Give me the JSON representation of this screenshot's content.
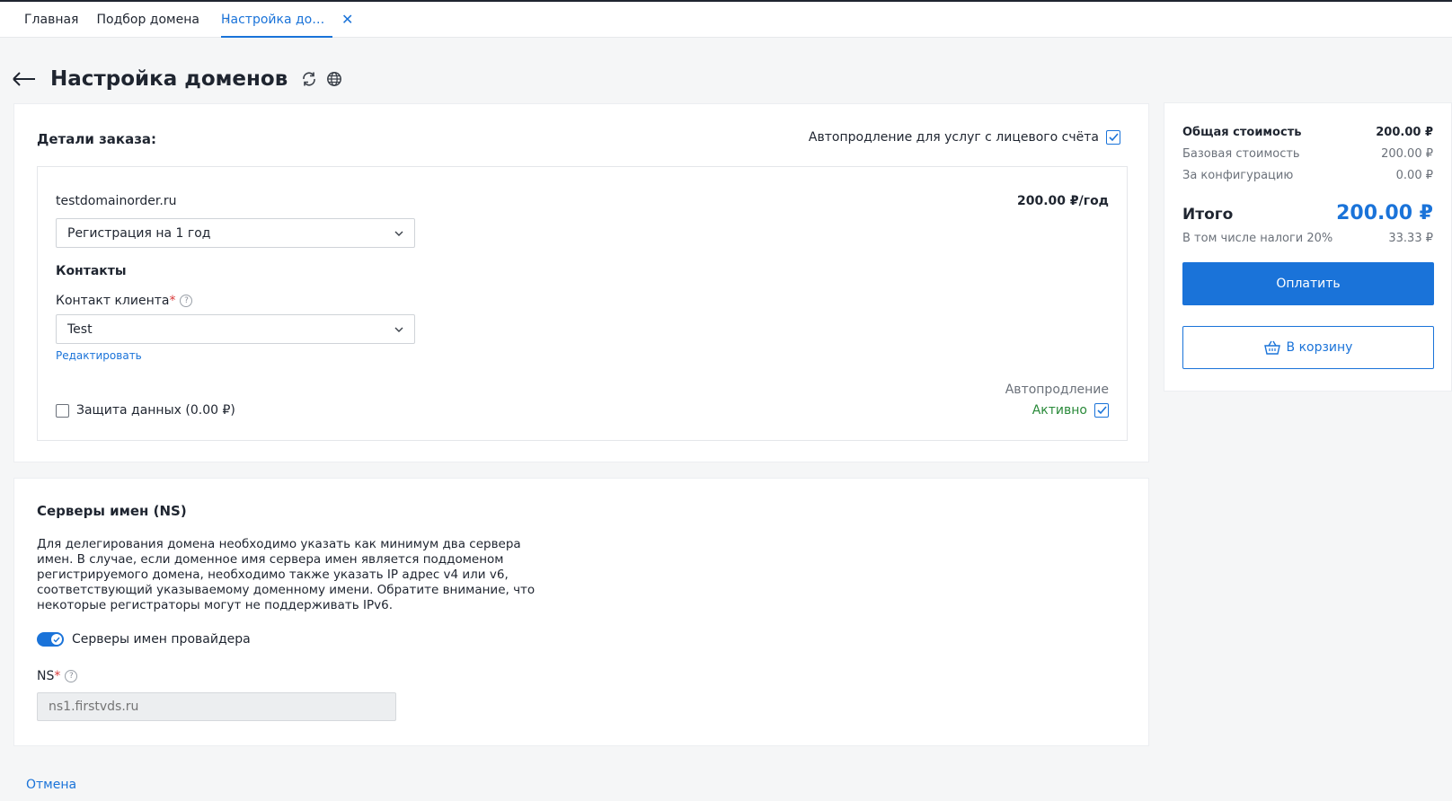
{
  "nav": {
    "home": "Главная",
    "domain_search": "Подбор домена",
    "active_tab": "Настройка доме...",
    "close": "✕"
  },
  "header": {
    "title": "Настройка доменов"
  },
  "order": {
    "title": "Детали заказа:",
    "autorenew_label": "Автопродление для услуг с лицевого счёта",
    "autorenew_checked": true,
    "domain": {
      "name": "testdomainorder.ru",
      "price": "200.00 ₽/год",
      "period_selected": "Регистрация на 1 год",
      "contacts_heading": "Контакты",
      "contact_label": "Контакт клиента",
      "required_mark": "*",
      "help": "?",
      "contact_selected": "Test",
      "edit_link": "Редактировать",
      "data_protection_label": "Защита данных (0.00 ₽)",
      "data_protection_checked": false,
      "autorenew_label": "Автопродление",
      "autorenew_status": "Активно",
      "autorenew_checked": true
    }
  },
  "ns": {
    "title": "Серверы имен (NS)",
    "description": "Для делегирования домена необходимо указать как минимум два сервера имен. В случае, если доменное имя сервера имен является поддоменом регистрируемого домена, необходимо также указать IP адрес v4 или v6, соответствующий указываемому доменному имени. Обратите внимание, что некоторые регистраторы могут не поддерживать IPv6.",
    "toggle_label": "Серверы имен провайдера",
    "toggle_on": true,
    "field_label": "NS",
    "required_mark": "*",
    "help": "?",
    "field_placeholder": "ns1.firstvds.ru"
  },
  "summary": {
    "total_cost_label": "Общая стоимость",
    "total_cost_value": "200.00 ₽",
    "base_cost_label": "Базовая стоимость",
    "base_cost_value": "200.00 ₽",
    "config_label": "За конфигурацию",
    "config_value": "0.00 ₽",
    "itogo_label": "Итого",
    "itogo_value": "200.00 ₽",
    "tax_label": "В том числе налоги 20%",
    "tax_value": "33.33 ₽",
    "pay_button": "Оплатить",
    "cart_button": "В корзину"
  },
  "footer": {
    "cancel": "Отмена"
  },
  "colors": {
    "accent": "#1a73d9",
    "active_status": "#2a8a3a",
    "required": "#d93a3a"
  },
  "icons": {
    "back": "arrow-left-icon",
    "refresh": "refresh-icon",
    "globe": "globe-icon",
    "basket": "basket-icon",
    "chevron": "chevron-down-icon",
    "help": "help-icon",
    "close": "close-icon"
  }
}
